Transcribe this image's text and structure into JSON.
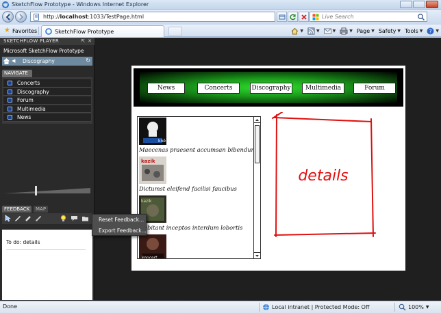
{
  "window": {
    "title": "SketchFlow Prototype - Windows Internet Explorer"
  },
  "address": {
    "url_prefix": "http://",
    "url_host": "localhost",
    "url_path": ":1033/TestPage.html"
  },
  "search": {
    "placeholder": "Live Search"
  },
  "favorites": {
    "label": "Favorites"
  },
  "tab": {
    "label": "SketchFlow Prototype"
  },
  "commands": {
    "page": "Page",
    "safety": "Safety",
    "tools": "Tools"
  },
  "player": {
    "header": "SKETCHFLOW PLAYER",
    "project": "Microsoft SketchFlow Prototype",
    "breadcrumb": "Discography",
    "navigate_tab": "NAVIGATE",
    "nav_items": [
      {
        "label": "Concerts"
      },
      {
        "label": "Discography"
      },
      {
        "label": "Forum"
      },
      {
        "label": "Multimedia"
      },
      {
        "label": "News"
      }
    ],
    "feedback_tab": "FEEDBACK",
    "map_tab": "MAP",
    "feedback_note": "To do: details",
    "context_menu": {
      "reset": "Reset Feedback...",
      "export": "Export Feedback..."
    }
  },
  "prototype": {
    "menu": [
      {
        "label": "News"
      },
      {
        "label": "Concerts"
      },
      {
        "label": "Discography"
      },
      {
        "label": "Multimedia"
      },
      {
        "label": "Forum"
      }
    ],
    "list": [
      {
        "caption": "Maecenas praesent accumsan bibendum",
        "thumb_text": "knê"
      },
      {
        "caption": "Dictumst eleifend facilisi faucibus",
        "thumb_text": "kazik"
      },
      {
        "caption": "Habitant inceptos interdum lobortis",
        "thumb_text": "kazik"
      },
      {
        "caption": "",
        "thumb_text": "koncert"
      }
    ],
    "details_sketch_text": "details"
  },
  "status": {
    "done": "Done",
    "zone": "Local intranet | Protected Mode: Off",
    "zoom": "100%"
  },
  "colors": {
    "player_bg": "#2a2a2a",
    "crumb": "#6d8aa0",
    "sketch_red": "#e01010",
    "header_green": "#1a9a1a"
  }
}
